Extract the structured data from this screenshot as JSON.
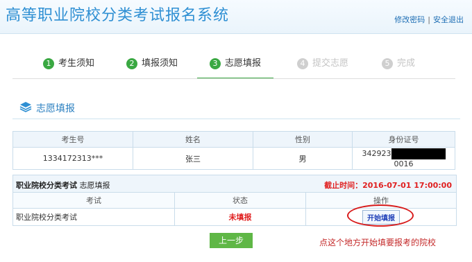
{
  "header": {
    "title": "高等职业院校分类考试报名系统",
    "links": {
      "change_password": "修改密码",
      "separator": "|",
      "logout": "安全退出"
    }
  },
  "steps": [
    {
      "num": "1",
      "label": "考生须知",
      "state": "done"
    },
    {
      "num": "2",
      "label": "填报须知",
      "state": "done"
    },
    {
      "num": "3",
      "label": "志愿填报",
      "state": "active"
    },
    {
      "num": "4",
      "label": "提交志愿",
      "state": "disabled"
    },
    {
      "num": "5",
      "label": "完成",
      "state": "disabled"
    }
  ],
  "section": {
    "title": "志愿填报",
    "icon": "layers-icon"
  },
  "student_table": {
    "headers": [
      "考生号",
      "姓名",
      "性别",
      "身份证号"
    ],
    "row": {
      "exam_no": "1334172313***",
      "name": "张三",
      "gender": "男",
      "id_prefix": "342923",
      "id_suffix": "0016"
    }
  },
  "exam_box": {
    "heading_bold": "职业院校分类考试",
    "heading_rest": " 志愿填报",
    "deadline": "截止时间：2016-07-01 17:00:00",
    "headers": [
      "考试",
      "状态",
      "操作"
    ],
    "row": {
      "exam": "职业院校分类考试",
      "status": "未填报",
      "action": "开始填报"
    }
  },
  "footer": {
    "prev_button": "上一步",
    "annotation": "点这个地方开始填要报考的院校"
  },
  "colors": {
    "accent": "#2e8fd3",
    "step_green": "#3aa842",
    "alert_red": "#e02020",
    "button_green": "#5fb746"
  }
}
